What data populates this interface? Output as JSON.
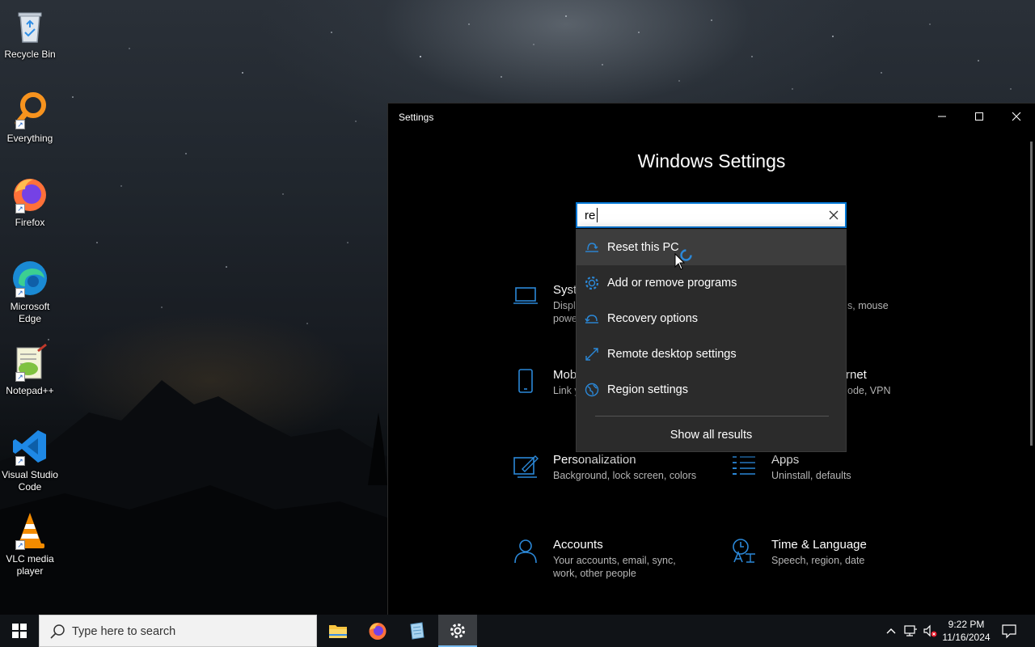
{
  "desktop": {
    "icons": [
      {
        "label": "Recycle Bin"
      },
      {
        "label": "Everything"
      },
      {
        "label": "Firefox"
      },
      {
        "label": "Microsoft Edge"
      },
      {
        "label": "Notepad++"
      },
      {
        "label": "Visual Studio Code"
      },
      {
        "label": "VLC media player"
      }
    ]
  },
  "window": {
    "title": "Settings",
    "heading": "Windows Settings",
    "search": {
      "value": "re"
    },
    "suggestions": [
      {
        "label": "Reset this PC",
        "icon": "reset-pc-icon"
      },
      {
        "label": "Add or remove programs",
        "icon": "gear-icon"
      },
      {
        "label": "Recovery options",
        "icon": "recovery-icon"
      },
      {
        "label": "Remote desktop settings",
        "icon": "remote-desktop-icon"
      },
      {
        "label": "Region settings",
        "icon": "globe-icon"
      }
    ],
    "show_all": "Show all results",
    "categories": {
      "system": {
        "title": "Syste",
        "desc": "Displ\npowe"
      },
      "devices": {
        "desc": "s, mouse"
      },
      "phone": {
        "title": "Mob",
        "desc": "Link y"
      },
      "network": {
        "title": "rnet",
        "desc": "ode, VPN"
      },
      "personalization": {
        "title": "Personalization",
        "desc": "Background, lock screen, colors"
      },
      "apps": {
        "title": "Apps",
        "desc": "Uninstall, defaults"
      },
      "accounts": {
        "title": "Accounts",
        "desc": "Your accounts, email, sync, work, other people"
      },
      "time": {
        "title": "Time & Language",
        "desc": "Speech, region, date"
      }
    },
    "accent_color": "#0078d7"
  },
  "taskbar": {
    "search_placeholder": "Type here to search",
    "clock": {
      "time": "9:22 PM",
      "date": "11/16/2024"
    }
  }
}
